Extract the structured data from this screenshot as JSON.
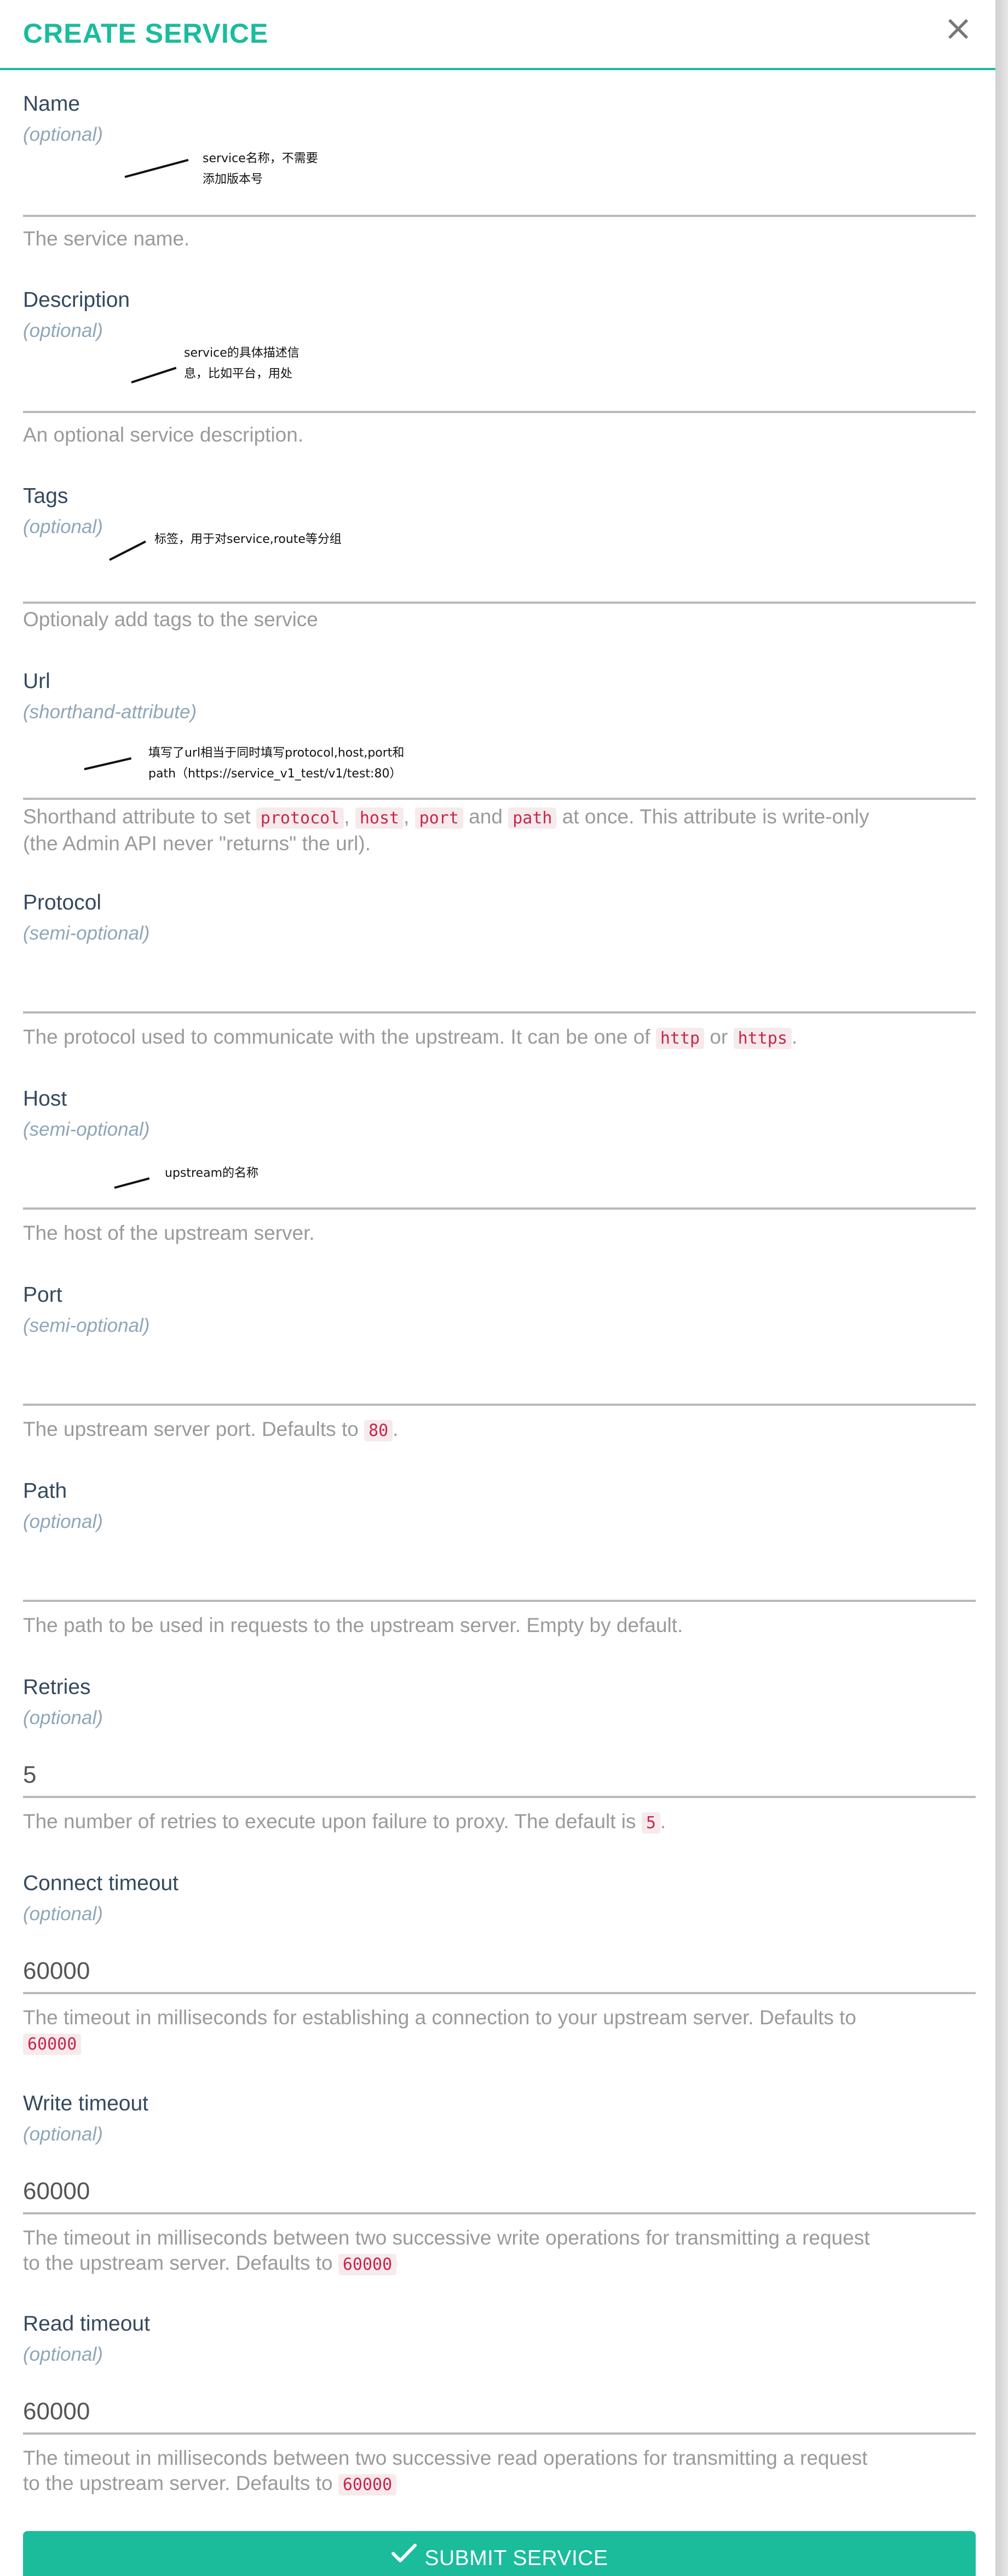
{
  "modal": {
    "title": "CREATE SERVICE",
    "close_glyph": "×",
    "submit_label": "SUBMIT SERVICE",
    "submit_icon": "check-icon",
    "accent": "#1abc9c"
  },
  "fields": {
    "name": {
      "label": "Name",
      "hint": "(optional)",
      "value": "",
      "help": "The service name.",
      "annotation_1": "service名称，不需要",
      "annotation_2": "添加版本号"
    },
    "description": {
      "label": "Description",
      "hint": "(optional)",
      "value": "",
      "help": "An optional service description.",
      "annotation_1": "service的具体描述信",
      "annotation_2": "息，比如平台，用处"
    },
    "tags": {
      "label": "Tags",
      "hint": "(optional)",
      "value": "",
      "help": "Optionaly add tags to the service",
      "annotation_1": "标签，用于对service,route等分组"
    },
    "url": {
      "label": "Url",
      "hint": "(shorthand-attribute)",
      "value": "",
      "help_1": "Shorthand attribute to set",
      "code_1": "protocol",
      "sep_1": ",",
      "code_2": "host",
      "sep_2": ",",
      "code_3": "port",
      "sep_3": "and",
      "code_4": "path",
      "help_2": "at once. This attribute is write-only",
      "help_3": "(the Admin API never \"returns\" the url).",
      "annotation_1": "填写了url相当于同时填写protocol,host,port和",
      "annotation_2": "path（https://service_v1_test/v1/test:80）"
    },
    "protocol": {
      "label": "Protocol",
      "hint": "(semi-optional)",
      "value": "",
      "help_1": "The protocol used to communicate with the upstream. It can be one of",
      "code_1": "http",
      "sep_1": "or",
      "code_2": "https",
      "help_2": "."
    },
    "host": {
      "label": "Host",
      "hint": "(semi-optional)",
      "value": "",
      "help": "The host of the upstream server.",
      "annotation_1": "upstream的名称"
    },
    "port": {
      "label": "Port",
      "hint": "(semi-optional)",
      "value": "",
      "help_1": "The upstream server port. Defaults to",
      "code_1": "80",
      "help_2": "."
    },
    "path": {
      "label": "Path",
      "hint": "(optional)",
      "value": "",
      "help": "The path to be used in requests to the upstream server. Empty by default."
    },
    "retries": {
      "label": "Retries",
      "hint": "(optional)",
      "value": "5",
      "help_1": "The number of retries to execute upon failure to proxy. The default is",
      "code_1": "5",
      "help_2": "."
    },
    "connect_timeout": {
      "label": "Connect timeout",
      "hint": "(optional)",
      "value": "60000",
      "help_1": "The timeout in milliseconds for establishing a connection to your upstream server. Defaults to",
      "code_1": "60000"
    },
    "write_timeout": {
      "label": "Write timeout",
      "hint": "(optional)",
      "value": "60000",
      "help_1": "The timeout in milliseconds between two successive write operations for transmitting a request",
      "help_2": "to the upstream server. Defaults to",
      "code_1": "60000"
    },
    "read_timeout": {
      "label": "Read timeout",
      "hint": "(optional)",
      "value": "60000",
      "help_1": "The timeout in milliseconds between two successive read operations for transmitting a request",
      "help_2": "to the upstream server. Defaults to",
      "code_1": "60000"
    }
  }
}
